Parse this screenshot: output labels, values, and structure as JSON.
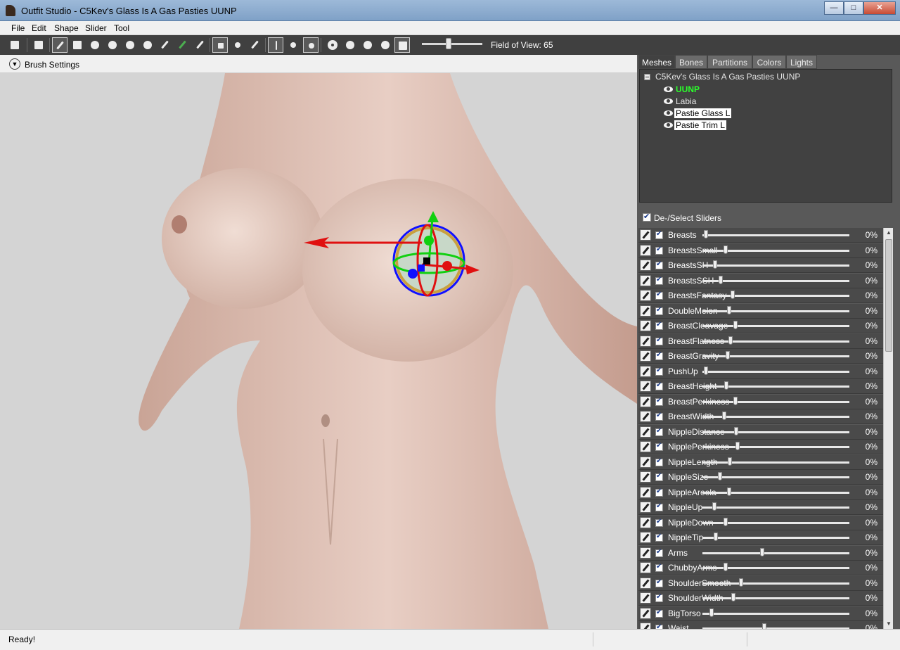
{
  "window": {
    "title": "Outfit Studio - C5Kev's Glass Is A Gas Pasties UUNP",
    "minimize": "—",
    "maximize": "□",
    "close": "✕"
  },
  "menu": [
    "File",
    "Edit",
    "Shape",
    "Slider",
    "Tool"
  ],
  "toolbar": {
    "field_of_view_label": "Field of View: 65",
    "field_of_view_value": 65
  },
  "brush_settings": {
    "label": "Brush Settings"
  },
  "tabs": [
    "Meshes",
    "Bones",
    "Partitions",
    "Colors",
    "Lights"
  ],
  "mesh_tree": {
    "root": "C5Kev's Glass Is A Gas Pasties UUNP",
    "nodes": [
      "UUNP",
      "Labia",
      "Pastie Glass L",
      "Pastie Trim L"
    ]
  },
  "sliders_header": {
    "label": "De-/Select Sliders"
  },
  "sliders": [
    {
      "name": "Breasts",
      "value": "0%"
    },
    {
      "name": "BreastsSmall",
      "value": "0%"
    },
    {
      "name": "BreastsSH",
      "value": "0%"
    },
    {
      "name": "BreastsSSH",
      "value": "0%"
    },
    {
      "name": "BreastsFantasy",
      "value": "0%"
    },
    {
      "name": "DoubleMelon",
      "value": "0%"
    },
    {
      "name": "BreastCleavage",
      "value": "0%"
    },
    {
      "name": "BreastFlatness",
      "value": "0%"
    },
    {
      "name": "BreastGravity",
      "value": "0%"
    },
    {
      "name": "PushUp",
      "value": "0%"
    },
    {
      "name": "BreastHeight",
      "value": "0%"
    },
    {
      "name": "BreastPerkiness",
      "value": "0%"
    },
    {
      "name": "BreastWidth",
      "value": "0%"
    },
    {
      "name": "NippleDistance",
      "value": "0%"
    },
    {
      "name": "NipplePerkiness",
      "value": "0%"
    },
    {
      "name": "NippleLength",
      "value": "0%"
    },
    {
      "name": "NippleSize",
      "value": "0%"
    },
    {
      "name": "NippleAreola",
      "value": "0%"
    },
    {
      "name": "NippleUp",
      "value": "0%"
    },
    {
      "name": "NippleDown",
      "value": "0%"
    },
    {
      "name": "NippleTip",
      "value": "0%"
    },
    {
      "name": "Arms",
      "value": "0%"
    },
    {
      "name": "ChubbyArms",
      "value": "0%"
    },
    {
      "name": "ShoulderSmooth",
      "value": "0%"
    },
    {
      "name": "ShoulderWidth",
      "value": "0%"
    },
    {
      "name": "BigTorso",
      "value": "0%"
    },
    {
      "name": "Waist",
      "value": "0%"
    }
  ],
  "status": {
    "text": "Ready!"
  },
  "colors": {
    "toolbar_bg": "#404040",
    "panel_bg": "#595959",
    "viewport_bg": "#d4d4d4",
    "active_mesh": "#2bff2b"
  }
}
